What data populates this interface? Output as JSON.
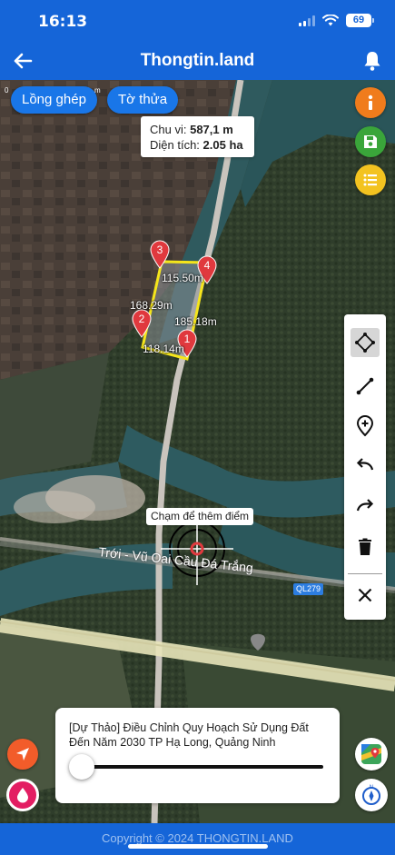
{
  "status_bar": {
    "time": "16:13",
    "battery": "69"
  },
  "app_bar": {
    "title": "Thongtin.land"
  },
  "map": {
    "layer_buttons": [
      {
        "label": "Lồng ghép"
      },
      {
        "label": "Tờ thửa"
      }
    ],
    "measure": {
      "perimeter_label": "Chu vi:",
      "perimeter_value": "587,1 m",
      "area_label": "Diện tích:",
      "area_value": "2.05 ha"
    },
    "markers": [
      "1",
      "2",
      "3",
      "4"
    ],
    "segment_lengths": [
      "115.50m",
      "168.29m",
      "185.18m",
      "118.14m"
    ],
    "hint": "Chạm để thêm điểm",
    "road_label": "Trới - Vũ Oai",
    "bridge_label": "Cầu Đá Trắng",
    "highway_badge": "QL279",
    "tiny_marks": [
      "0",
      "m"
    ]
  },
  "right_actions": [
    "info-icon",
    "save-icon",
    "list-icon"
  ],
  "draw_tools": [
    "move-vertex-icon",
    "draw-line-icon",
    "add-point-icon",
    "undo-icon",
    "redo-icon",
    "trash-icon",
    "close-icon"
  ],
  "layer_card": {
    "name": "[Dự Thảo] Điều Chỉnh Quy Hoạch Sử Dụng Đất Đến Năm 2030 TP Hạ Long, Quảng Ninh",
    "opacity": 0
  },
  "footer": {
    "copyright": "Copyright © 2024 THONGTIN.LAND"
  },
  "colors": {
    "brand_blue": "#1565d8",
    "parcel_outline": "#f5e51b",
    "marker_red": "#e0393e",
    "info_orange": "#f07c1c",
    "save_green": "#3aa53a",
    "list_yellow": "#f3c320"
  }
}
